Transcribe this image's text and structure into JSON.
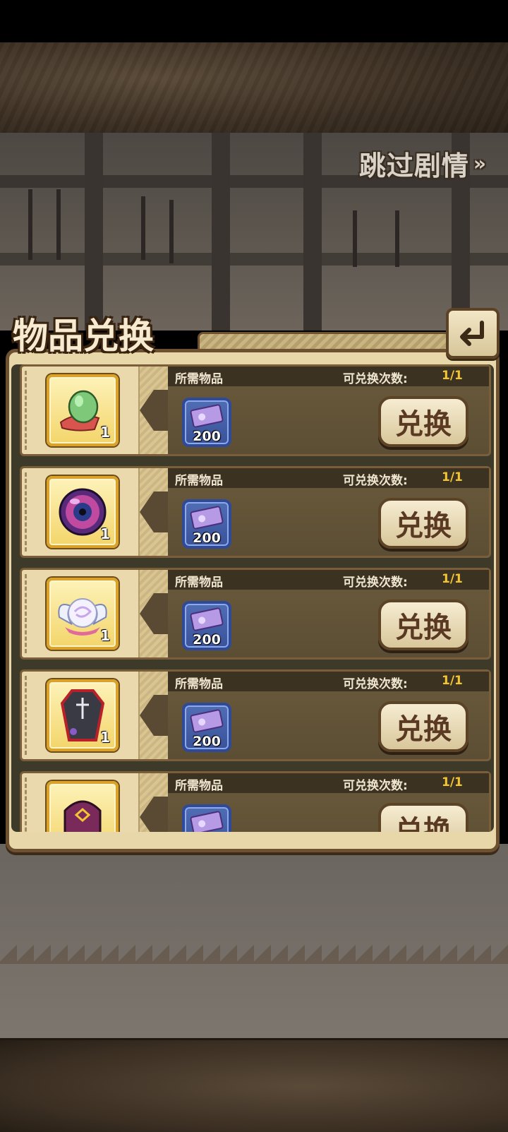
{
  "header": {
    "skip_label": "跳过剧情",
    "skip_chevron": "»"
  },
  "panel": {
    "title": "物品兑换",
    "back_icon": "return-arrow-icon"
  },
  "labels": {
    "required_items": "所需物品",
    "exchange_count": "可兑换次数:",
    "exchange_button": "兑换"
  },
  "rows": [
    {
      "item": "green-egg-item-icon",
      "item_qty": "1",
      "cost_icon": "purple-ticket-icon",
      "cost": "200",
      "count": "1/1"
    },
    {
      "item": "purple-orb-item-icon",
      "item_qty": "1",
      "cost_icon": "purple-ticket-icon",
      "cost": "200",
      "count": "1/1"
    },
    {
      "item": "winged-pearl-item-icon",
      "item_qty": "1",
      "cost_icon": "purple-ticket-icon",
      "cost": "200",
      "count": "1/1"
    },
    {
      "item": "coffin-item-icon",
      "item_qty": "1",
      "cost_icon": "purple-ticket-icon",
      "cost": "200",
      "count": "1/1"
    },
    {
      "item": "masked-head-item-icon",
      "item_qty": "",
      "cost_icon": "purple-ticket-icon",
      "cost": "",
      "count": "1/1"
    }
  ]
}
